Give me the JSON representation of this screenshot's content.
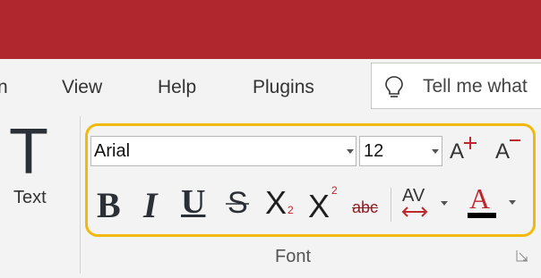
{
  "menu": {
    "partial_item": "n",
    "items": [
      "View",
      "Help",
      "Plugins"
    ]
  },
  "tell_me": {
    "text": "Tell me what"
  },
  "text_group": {
    "glyph": "T",
    "label": "Text"
  },
  "font_group": {
    "label": "Font",
    "font_name": "Arial",
    "font_size": "12",
    "buttons": {
      "grow_glyph": "A",
      "shrink_glyph": "A",
      "bold": "B",
      "italic": "I",
      "underline": "U",
      "strike": "S",
      "subscript": "X",
      "subscript_mark": "2",
      "superscript": "X",
      "superscript_mark": "2",
      "strikethrough_abc": "abc",
      "spacing": "AV",
      "color": "A"
    }
  },
  "colors": {
    "titlebar": "#b0272e",
    "highlight": "#f2b90c",
    "accent_red": "#c0272d"
  },
  "icons": {
    "bulb": "lightbulb-icon",
    "launcher": "dialog-launcher-icon"
  }
}
